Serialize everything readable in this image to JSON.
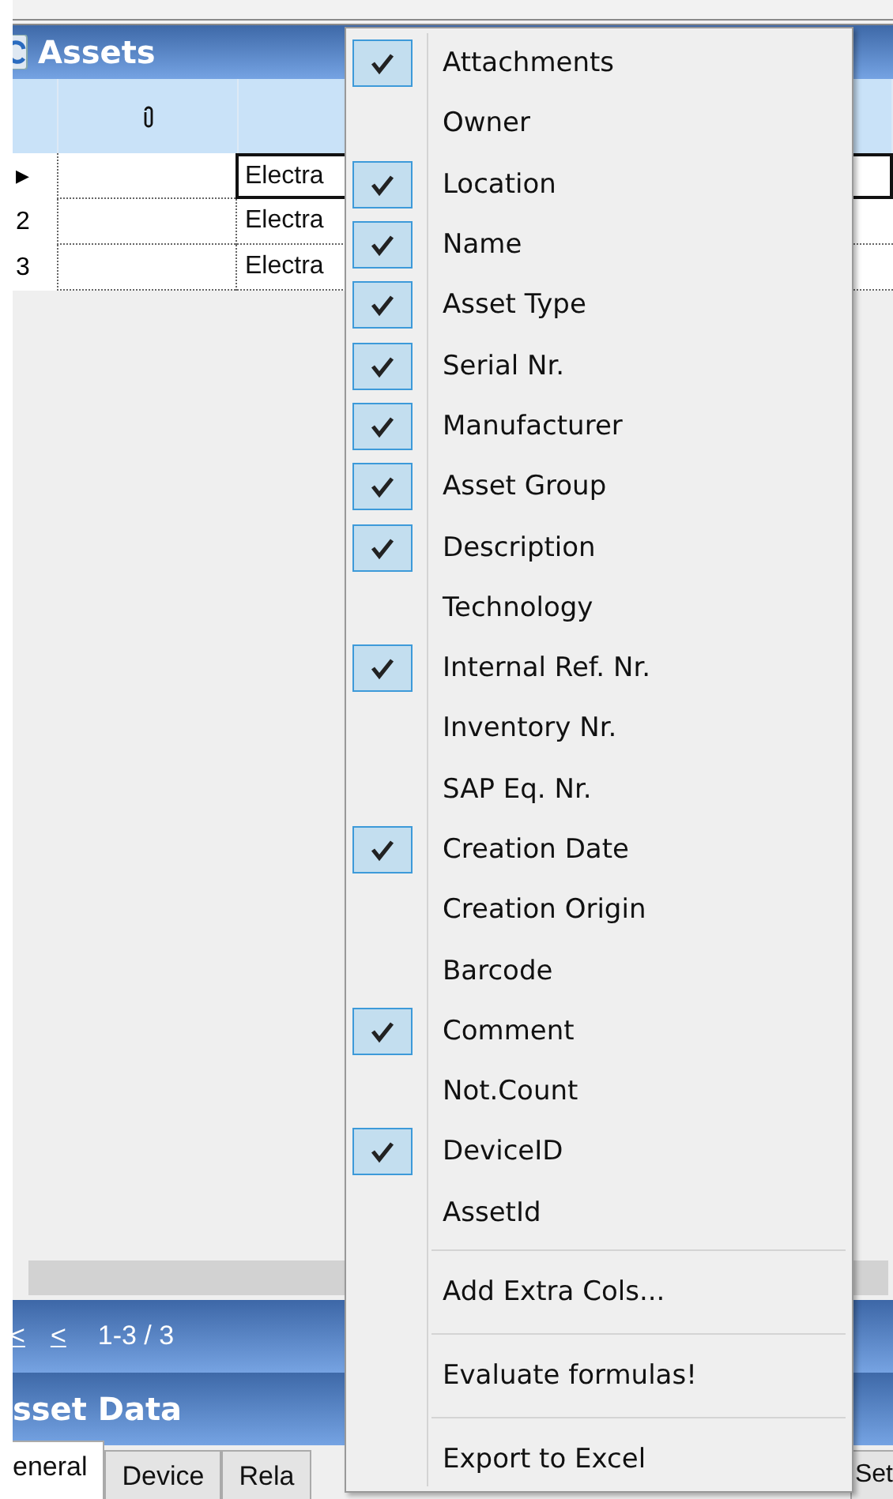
{
  "assets_panel": {
    "title": "Assets",
    "rows": [
      {
        "indicator": "▶",
        "kind": "current",
        "name": "Electra"
      },
      {
        "indicator": "2",
        "kind": "number",
        "name": "Electra"
      },
      {
        "indicator": "3",
        "kind": "number",
        "name": "Electra"
      }
    ],
    "navigation": {
      "first": "<",
      "previous": "<",
      "range": "1-3 / 3"
    }
  },
  "asset_data_panel": {
    "title": "sset Data",
    "tabs": [
      {
        "label": "eneral",
        "selected": true
      },
      {
        "label": "Device",
        "selected": false
      },
      {
        "label": "Rela",
        "selected": false
      },
      {
        "label": "Set",
        "selected": false
      }
    ]
  },
  "context_menu": {
    "columns": [
      {
        "label": "Attachments",
        "checked": true
      },
      {
        "label": "Owner",
        "checked": false
      },
      {
        "label": "Location",
        "checked": true
      },
      {
        "label": "Name",
        "checked": true
      },
      {
        "label": "Asset Type",
        "checked": true
      },
      {
        "label": "Serial Nr.",
        "checked": true
      },
      {
        "label": "Manufacturer",
        "checked": true
      },
      {
        "label": "Asset Group",
        "checked": true
      },
      {
        "label": "Description",
        "checked": true
      },
      {
        "label": "Technology",
        "checked": false
      },
      {
        "label": "Internal Ref. Nr.",
        "checked": true
      },
      {
        "label": "Inventory Nr.",
        "checked": false
      },
      {
        "label": "SAP Eq. Nr.",
        "checked": false
      },
      {
        "label": "Creation Date",
        "checked": true
      },
      {
        "label": "Creation Origin",
        "checked": false
      },
      {
        "label": "Barcode",
        "checked": false
      },
      {
        "label": "Comment",
        "checked": true
      },
      {
        "label": "Not.Count",
        "checked": false
      },
      {
        "label": "DeviceID",
        "checked": true
      },
      {
        "label": "AssetId",
        "checked": false
      }
    ],
    "actions": [
      "Add Extra Cols...",
      "Evaluate formulas!",
      "Export to Excel"
    ]
  }
}
